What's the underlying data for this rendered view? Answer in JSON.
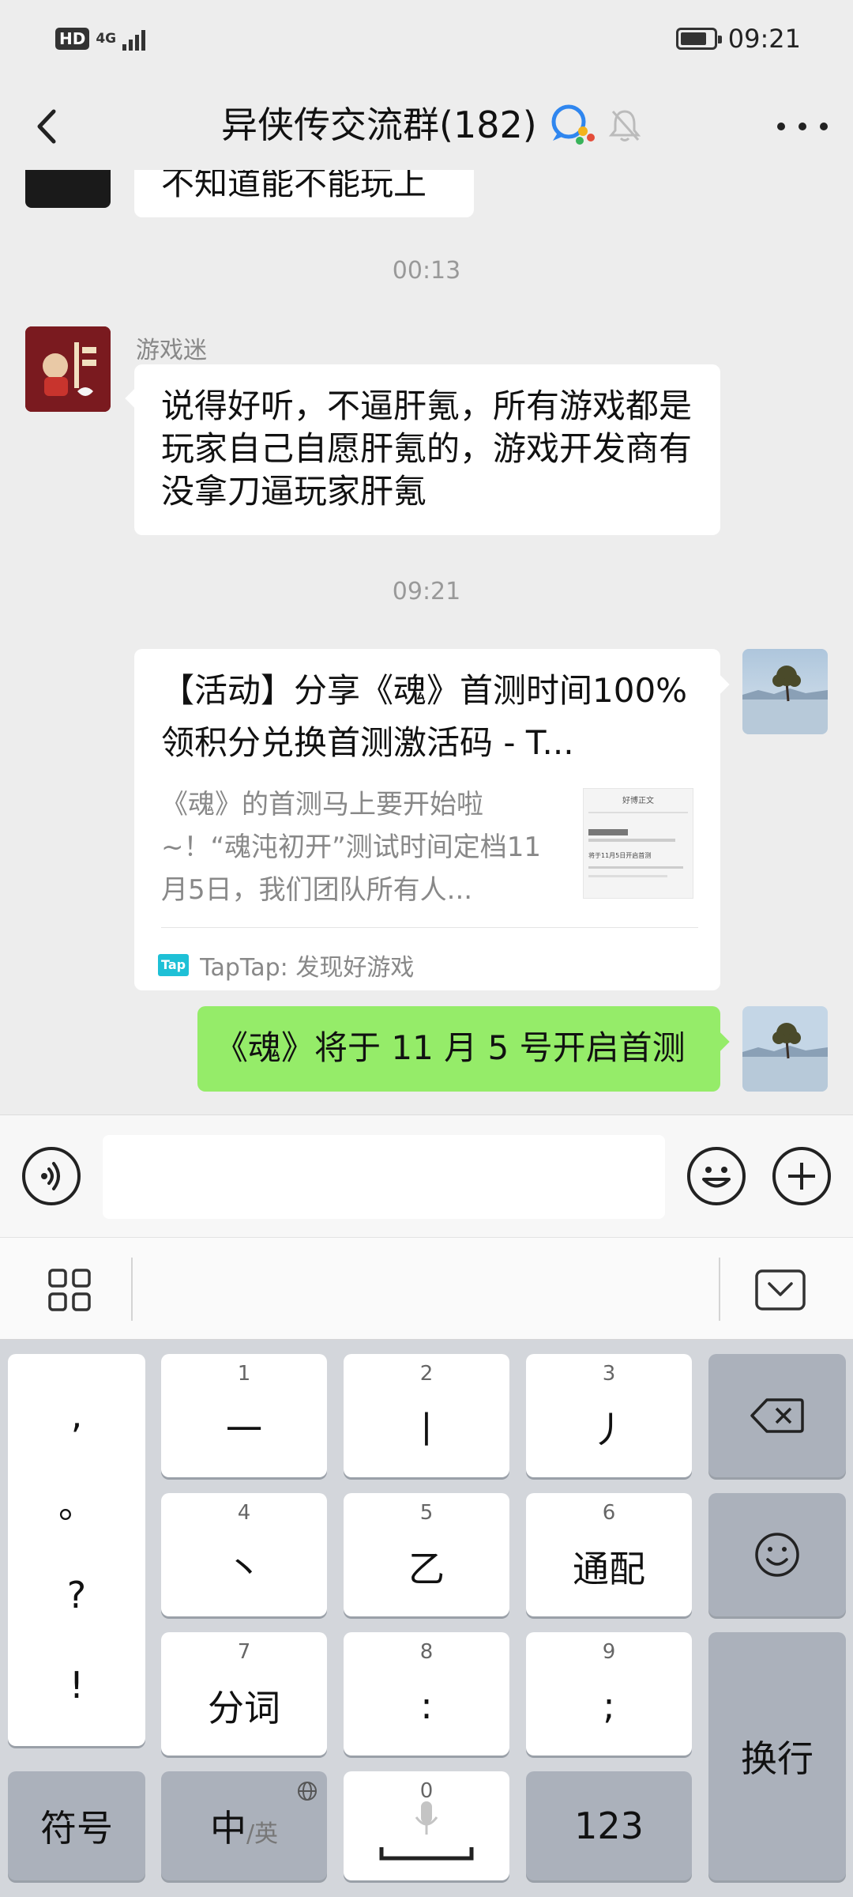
{
  "status_bar": {
    "hd_label": "HD",
    "network": "4G",
    "time": "09:21",
    "battery_level": 0.8
  },
  "header": {
    "title": "异侠传交流群(182)"
  },
  "messages": {
    "clipped_text": "不知道能不能玩上",
    "timestamp_1": "00:13",
    "msg1_sender": "游戏迷",
    "msg1_text": "说得好听，不逼肝氪，所有游戏都是玩家自己自愿肝氪的，游戏开发商有没拿刀逼玩家肝氪",
    "timestamp_2": "09:21",
    "link_card": {
      "title": "【活动】分享《魂》首测时间100%领积分兑换首测激活码 - T...",
      "description": "《魂》的首测马上要开始啦~！“魂沌初开”测试时间定档11月5日，我们团队所有人...",
      "source_tag": "Tap",
      "source": "TapTap: 发现好游戏",
      "thumb_heading": "好博正文",
      "thumb_line": "将于11月5日开启首测"
    },
    "msg3_text": "《魂》将于 11 月 5 号开启首测"
  },
  "keyboard": {
    "punct": [
      ",",
      "。",
      "?",
      "!"
    ],
    "keys": [
      {
        "num": "1",
        "label": "一"
      },
      {
        "num": "2",
        "label": "丨"
      },
      {
        "num": "3",
        "label": "丿"
      },
      {
        "num": "4",
        "label": "丶"
      },
      {
        "num": "5",
        "label": "乙"
      },
      {
        "num": "6",
        "label": "通配"
      },
      {
        "num": "7",
        "label": "分词"
      },
      {
        "num": "8",
        "label": ":"
      },
      {
        "num": "9",
        "label": ";"
      }
    ],
    "enter": "换行",
    "symbols": "符号",
    "lang_main": "中",
    "lang_alt": "/英",
    "space_num": "0",
    "numbers": "123"
  },
  "colors": {
    "bg": "#ededed",
    "self_bubble": "#95ec69",
    "keyboard_bg": "#d3d6db"
  }
}
